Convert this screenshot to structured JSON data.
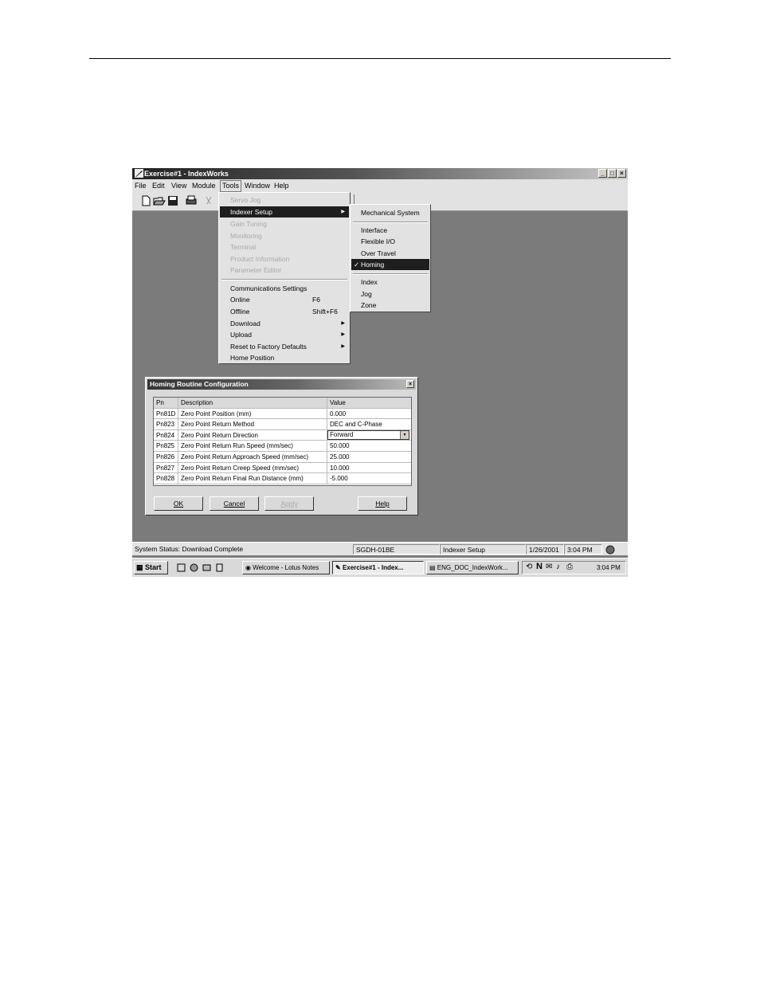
{
  "window": {
    "title": "Exercise#1 - IndexWorks",
    "min": "_",
    "max": "□",
    "close": "×"
  },
  "menubar": [
    "File",
    "Edit",
    "View",
    "Module",
    "Tools",
    "Window",
    "Help"
  ],
  "tools_menu": {
    "servo_jog": "Servo Jog",
    "indexer_setup": "Indexer Setup",
    "gain_tuning": "Gain Tuning",
    "monitoring": "Monitoring",
    "terminal": "Terminal",
    "product_info": "Product Information",
    "parameter_editor": "Parameter Editor",
    "comm_settings": "Communications Settings",
    "online": "Online",
    "online_shortcut": "F6",
    "offline": "Offline",
    "offline_shortcut": "Shift+F6",
    "download": "Download",
    "upload": "Upload",
    "reset_defaults": "Reset to Factory Defaults",
    "home_position": "Home Position"
  },
  "indexer_submenu": {
    "mechanical_system": "Mechanical System",
    "interface": "Interface",
    "flexible_io": "Flexible I/O",
    "over_travel": "Over Travel",
    "homing": "Homing",
    "index": "Index",
    "jog": "Jog",
    "zone": "Zone",
    "check": "✓"
  },
  "dialog": {
    "title": "Homing Routine Configuration",
    "close": "×",
    "headers": {
      "pn": "Pn",
      "description": "Description",
      "value": "Value"
    },
    "rows": [
      {
        "pn": "Pn81D",
        "description": "Zero Point Position (mm)",
        "value": "0.000"
      },
      {
        "pn": "Pn823",
        "description": "Zero Point Return Method",
        "value": "DEC and C-Phase"
      },
      {
        "pn": "Pn824",
        "description": "Zero Point Return Direction",
        "value": "Forward"
      },
      {
        "pn": "Pn825",
        "description": "Zero Point Return Run Speed (mm/sec)",
        "value": "50.000"
      },
      {
        "pn": "Pn826",
        "description": "Zero Point Return Approach Speed (mm/sec)",
        "value": "25.000"
      },
      {
        "pn": "Pn827",
        "description": "Zero Point Return Creep Speed (mm/sec)",
        "value": "10.000"
      },
      {
        "pn": "Pn828",
        "description": "Zero Point Return Final Run Distance (mm)",
        "value": "-5.000"
      }
    ],
    "buttons": {
      "ok": "OK",
      "cancel": "Cancel",
      "apply": "Apply",
      "help": "Help"
    }
  },
  "statusbar": {
    "status": "System Status: Download Complete",
    "model": "SGDH-01BE",
    "mode": "Indexer Setup",
    "date": "1/26/2001",
    "time": "3:04 PM"
  },
  "taskbar": {
    "start": "Start",
    "tasks": [
      "Welcome - Lotus Notes",
      "Exercise#1 - Index...",
      "ENG_DOC_IndexWork..."
    ],
    "tray_time": "3:04 PM"
  }
}
